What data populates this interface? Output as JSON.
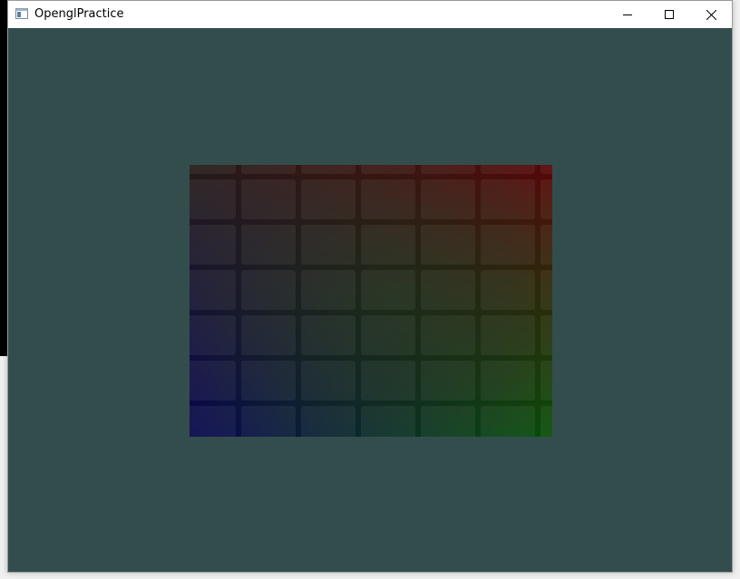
{
  "window": {
    "title": "OpenglPractice",
    "background_color": "#334d4d",
    "icons": {
      "app": "app-window-icon",
      "minimize": "minimize-icon",
      "maximize": "maximize-icon",
      "close": "close-icon"
    }
  },
  "texture": {
    "description_colors": {
      "top_right": "#ff0000",
      "bottom_right": "#00ff00",
      "bottom_left": "#0000ff",
      "top_left": "#ffff00"
    }
  }
}
